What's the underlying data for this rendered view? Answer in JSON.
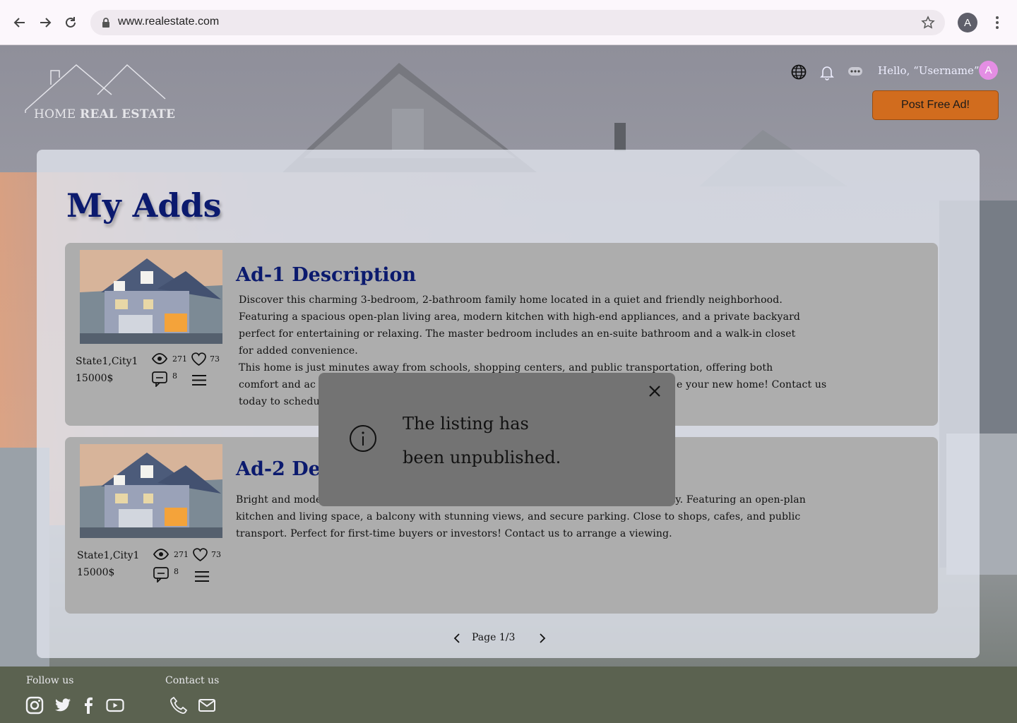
{
  "browser": {
    "url": "www.realestate.com",
    "profile_initial": "A"
  },
  "site": {
    "logo_word1": "HOME",
    "logo_word2": "REAL ESTATE",
    "greeting": "Hello, “Username”",
    "user_initial": "A",
    "post_ad_label": "Post Free Ad!",
    "accent_color": "#d16c1e",
    "title_color": "#0b1a6e"
  },
  "main": {
    "title": "My Adds",
    "ads": [
      {
        "title": "Ad-1 Description",
        "location": "State1,City1",
        "price": "15000$",
        "views": "271",
        "likes": "73",
        "comments": "8",
        "description": [
          "Discover this charming 3-bedroom, 2-bathroom family home located in a quiet and friendly neighborhood.",
          "Featuring a spacious open-plan living area,  modern kitchen with high-end appliances, and a private backyard",
          "perfect for entertaining or relaxing. The master bedroom includes an en-suite bathroom and a walk-in closet",
          "for added convenience.",
          "This home is just minutes away from schools, shopping centers, and public transportation, offering both",
          "comfort and ac",
          "today to schedu"
        ],
        "description_right": "e your new home! Contact us"
      },
      {
        "title": "Ad-2 Des",
        "location": "State1,City1",
        "price": "15000$",
        "views": "271",
        "likes": "73",
        "comments": "8",
        "description_line1_left": "Bright and mode",
        "description_line1_right": "ity. Featuring an open-plan",
        "description": [
          "kitchen and living space, a balcony with stunning views, and secure parking. Close to shops, cafes, and public",
          "transport. Perfect for first-time buyers or investors! Contact us to arrange a viewing."
        ]
      }
    ],
    "pagination": "Page 1/3"
  },
  "footer": {
    "follow_label": "Follow us",
    "contact_label": "Contact us"
  },
  "modal": {
    "line1": "The listing has",
    "line2": "been unpublished."
  }
}
